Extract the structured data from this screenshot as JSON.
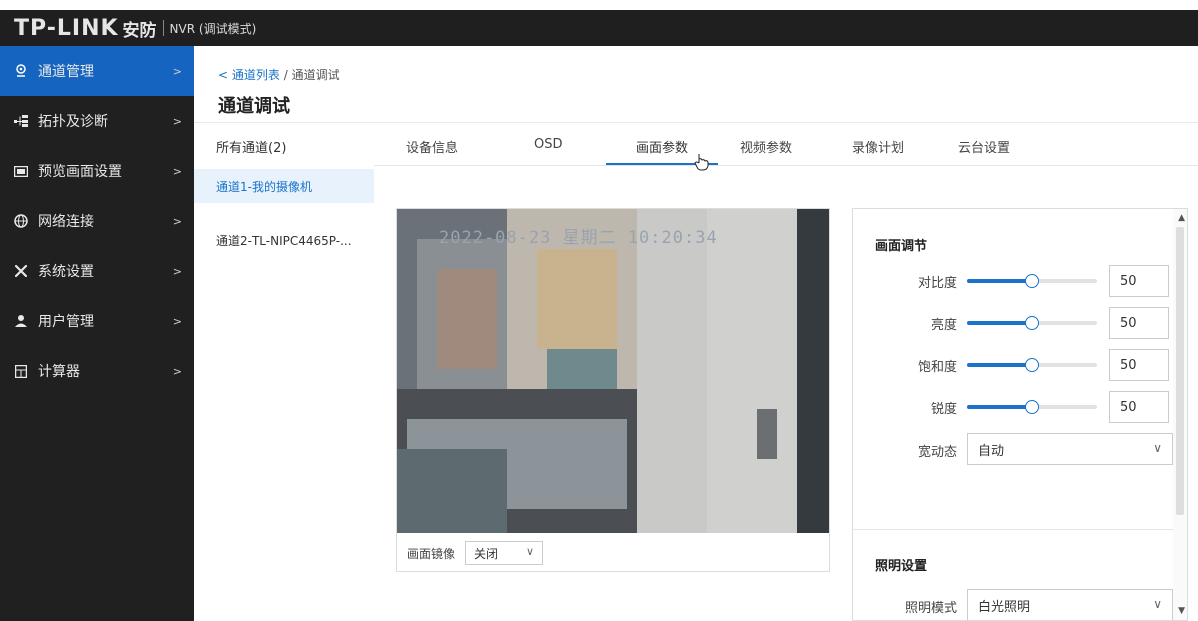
{
  "header": {
    "brand": "TP-LINK",
    "brand_cn": "安防",
    "mode": "NVR (调试模式)"
  },
  "sidebar": {
    "items": [
      {
        "label": "通道管理",
        "icon": "location-pin-icon",
        "arrow": ">",
        "active": true
      },
      {
        "label": "拓扑及诊断",
        "icon": "topology-icon",
        "arrow": ">"
      },
      {
        "label": "预览画面设置",
        "icon": "monitor-icon",
        "arrow": ">"
      },
      {
        "label": "网络连接",
        "icon": "globe-icon",
        "arrow": ">"
      },
      {
        "label": "系统设置",
        "icon": "tools-icon",
        "arrow": ">"
      },
      {
        "label": "用户管理",
        "icon": "user-icon",
        "arrow": ">"
      },
      {
        "label": "计算器",
        "icon": "calculator-icon",
        "arrow": ">"
      }
    ],
    "active_color": "#1565c0"
  },
  "breadcrumb": {
    "back": "< 通道列表",
    "sep": "/",
    "current": "通道调试"
  },
  "page_title": "通道调试",
  "channels": {
    "header": "所有通道(2)",
    "items": [
      {
        "label": "通道1-我的摄像机",
        "selected": true
      },
      {
        "label": "通道2-TL-NIPC4465P-..."
      }
    ]
  },
  "tabs": [
    {
      "label": "设备信息"
    },
    {
      "label": "OSD"
    },
    {
      "label": "画面参数",
      "active": true
    },
    {
      "label": "视频参数"
    },
    {
      "label": "录像计划"
    },
    {
      "label": "云台设置"
    }
  ],
  "video": {
    "osd": "2022-08-23 星期二 10:20:34",
    "mirror_label": "画面镜像",
    "mirror_value": "关闭"
  },
  "image_adjust": {
    "title": "画面调节",
    "sliders": [
      {
        "label": "对比度",
        "value": "50",
        "fraction": 0.5
      },
      {
        "label": "亮度",
        "value": "50",
        "fraction": 0.5
      },
      {
        "label": "饱和度",
        "value": "50",
        "fraction": 0.5
      },
      {
        "label": "锐度",
        "value": "50",
        "fraction": 0.5
      }
    ],
    "wdr_label": "宽动态",
    "wdr_value": "自动"
  },
  "lighting": {
    "title": "照明设置",
    "mode_label": "照明模式",
    "mode_value": "白光照明"
  },
  "accent_color": "#1a73c9"
}
